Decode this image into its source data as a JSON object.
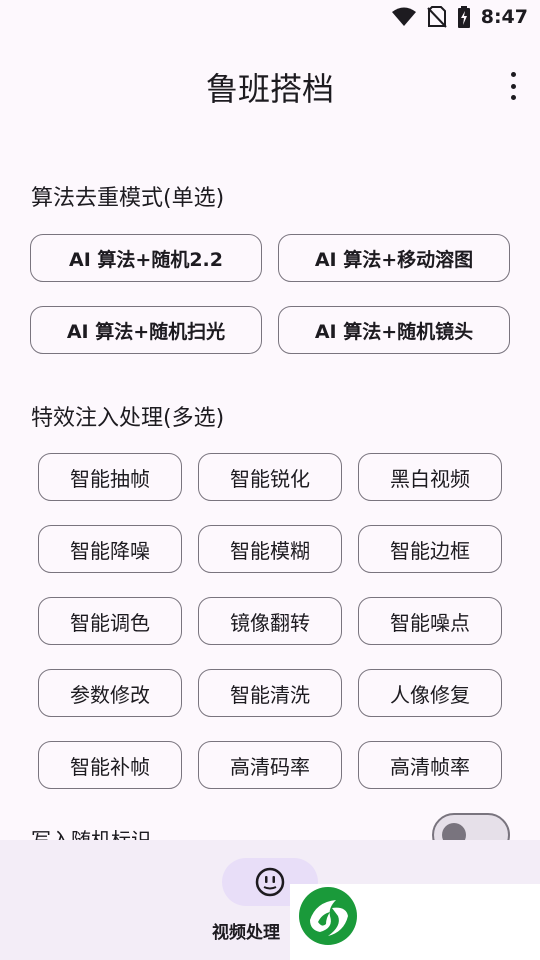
{
  "status_bar": {
    "time": "8:47"
  },
  "app_bar": {
    "title": "鲁班搭档"
  },
  "algo_section": {
    "title": "算法去重模式(单选)",
    "options": [
      "AI 算法+随机2.2",
      "AI 算法+移动溶图",
      "AI 算法+随机扫光",
      "AI 算法+随机镜头"
    ]
  },
  "fx_section": {
    "title": "特效注入处理(多选)",
    "options": [
      "智能抽帧",
      "智能锐化",
      "黑白视频",
      "智能降噪",
      "智能模糊",
      "智能边框",
      "智能调色",
      "镜像翻转",
      "智能噪点",
      "参数修改",
      "智能清洗",
      "人像修复",
      "智能补帧",
      "高清码率",
      "高清帧率"
    ]
  },
  "toggle_row": {
    "label": "写入随机标识",
    "enabled": false
  },
  "bottom_nav": {
    "label": "视频处理"
  },
  "colors": {
    "background": "#fdf8fd",
    "outline": "#79747e",
    "nav_background": "#f3edf7",
    "nav_indicator": "#e8def8",
    "ad_logo_green": "#1a9a3a"
  },
  "icons": [
    "wifi-icon",
    "no-sim-icon",
    "battery-charging-icon",
    "more-vert-icon",
    "face-icon",
    "ad-logo-icon"
  ]
}
